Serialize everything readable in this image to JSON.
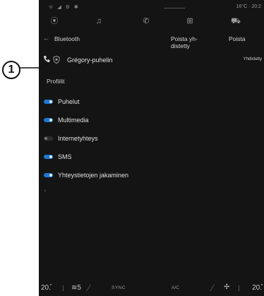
{
  "status": {
    "left": "ᯤ ◢ ⚙ ✱",
    "right": "16°C · 20:2"
  },
  "nav": {
    "icons": [
      {
        "name": "location-pin-icon",
        "glyph": "⦿"
      },
      {
        "name": "music-icon",
        "glyph": "♫"
      },
      {
        "name": "phone-icon",
        "glyph": "✆"
      },
      {
        "name": "apps-grid-icon",
        "glyph": "⊞"
      },
      {
        "name": "car-icon",
        "glyph": "⛟"
      }
    ]
  },
  "header": {
    "back": "←",
    "title": "Bluetooth",
    "disconnect": "Poista yh-distetty",
    "delete": "Poista"
  },
  "device": {
    "name": "Grégory-puhelin",
    "status": "Yhdistetty"
  },
  "profiles": {
    "title": "Profiilit",
    "items": [
      {
        "label": "Puhelut",
        "on": true
      },
      {
        "label": "Multimedia",
        "on": true
      },
      {
        "label": "Internetyhteys",
        "on": false
      },
      {
        "label": "SMS",
        "on": true
      },
      {
        "label": "Yhteystietojen jakaminen",
        "on": true
      }
    ]
  },
  "callout": {
    "number": "1"
  },
  "climate": {
    "left_temp": "20.̊",
    "seat": "≋5",
    "sync": "SYNC",
    "ac": "A/C",
    "fan": "✢",
    "right_temp": "20.̊"
  },
  "colors": {
    "background": "#141414",
    "toggle_on": "#1e78d2",
    "text": "#e0e0e0"
  }
}
